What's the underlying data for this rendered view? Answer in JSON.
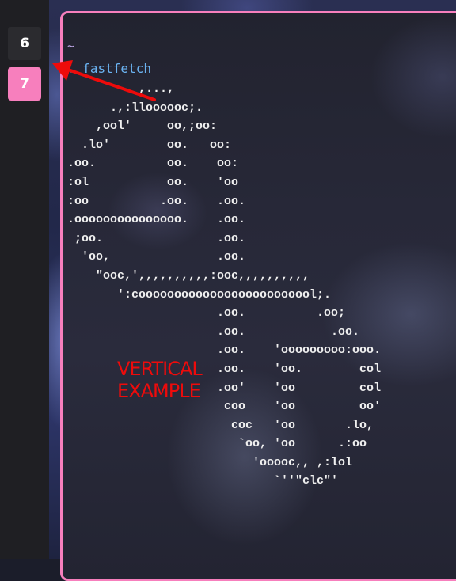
{
  "workspaces": [
    {
      "label": "6",
      "active": false
    },
    {
      "label": "7",
      "active": true
    }
  ],
  "terminal": {
    "prompt": "~",
    "command": "fastfetch",
    "logo_lines": [
      "          ,...,",
      "      .,:lloooooc;.",
      "    ,ool'     oo,;oo:",
      "  .lo'        oo.   oo:",
      ".oo.          oo.    oo:",
      ":ol           oo.    'oo",
      ":oo          .oo.    .oo.",
      ".ooooooooooooooo.    .oo.",
      " ;oo.                .oo.",
      "  'oo,               .oo.",
      "    \"ooc,',,,,,,,,,,:ooc,,,,,,,,,,",
      "       ':cooooooooooooooooooooooool;.",
      "                     .oo.          .oo;",
      "                     .oo.            .oo.",
      "                     .oo.    'ooooooooo:ooo.",
      "                     .oo.    'oo.        col",
      "                     .oo'    'oo         col",
      "                      coo    'oo         oo'",
      "                       coc   'oo       .lo,",
      "                        `oo, 'oo      .:oo",
      "                          'ooooc,, ,:lol",
      "                             `''\"clc\"'"
    ]
  },
  "annotation": {
    "line1": "VERTICAL",
    "line2": "EXAMPLE",
    "color": "#ee0b0b"
  },
  "colors": {
    "accent": "#f77fbd",
    "command": "#6bb3f2",
    "bar": "#1f1f23"
  }
}
